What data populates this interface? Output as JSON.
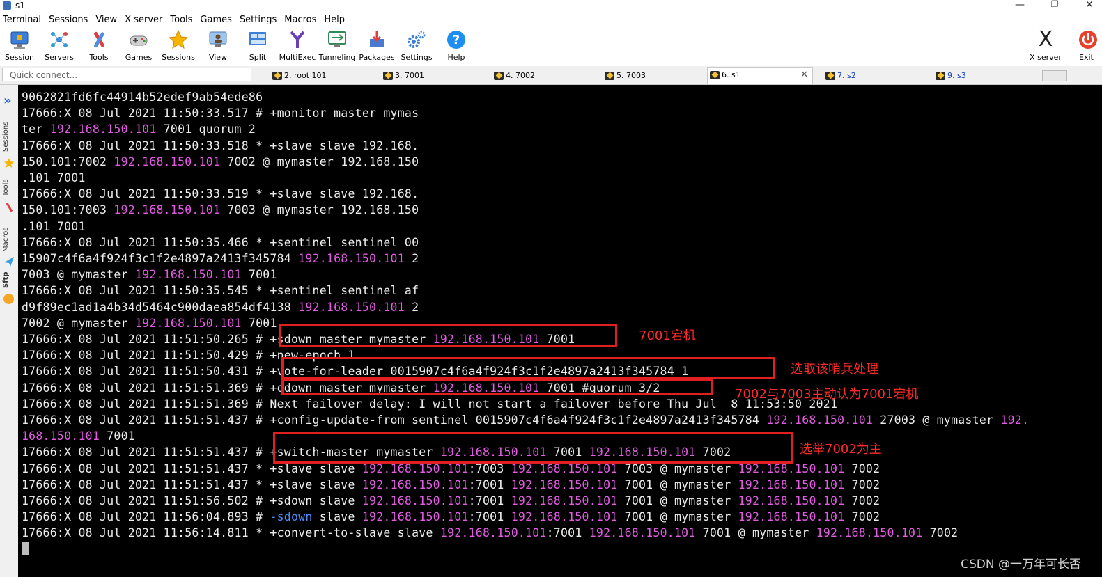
{
  "window": {
    "title": "s1",
    "min_glyph": "—",
    "max_glyph": "❐",
    "close_glyph": "✕"
  },
  "menu": [
    "Terminal",
    "Sessions",
    "View",
    "X server",
    "Tools",
    "Games",
    "Settings",
    "Macros",
    "Help"
  ],
  "toolbar": [
    {
      "label": "Session",
      "icon": "session-icon"
    },
    {
      "label": "Servers",
      "icon": "servers-icon"
    },
    {
      "label": "Tools",
      "icon": "tools-icon"
    },
    {
      "label": "Games",
      "icon": "games-icon"
    },
    {
      "label": "Sessions",
      "icon": "star-icon"
    },
    {
      "label": "View",
      "icon": "view-icon"
    },
    {
      "label": "Split",
      "icon": "split-icon"
    },
    {
      "label": "MultiExec",
      "icon": "multiexec-icon"
    },
    {
      "label": "Tunneling",
      "icon": "tunneling-icon"
    },
    {
      "label": "Packages",
      "icon": "packages-icon"
    },
    {
      "label": "Settings",
      "icon": "gear-icon"
    },
    {
      "label": "Help",
      "icon": "help-icon"
    }
  ],
  "xserver": {
    "label": "X server",
    "glyph": "X"
  },
  "exit": {
    "label": "Exit"
  },
  "quick_connect": {
    "placeholder": "Quick connect..."
  },
  "tabs": [
    {
      "label": "2. root 101",
      "active": false
    },
    {
      "label": "3. 7001",
      "active": false
    },
    {
      "label": "4. 7002",
      "active": false
    },
    {
      "label": "5. 7003",
      "active": false
    },
    {
      "label": "6. s1",
      "active": true
    },
    {
      "label": "7. s2",
      "active": false
    },
    {
      "label": "9. s3",
      "active": false
    }
  ],
  "tab_close": "✕",
  "side_panel": [
    "Sessions",
    "Tools",
    "Macros",
    "Sftp"
  ],
  "side_arrow": "»",
  "terminal_lines": [
    [
      {
        "t": "9062821fd6fc44914b52edef9ab54ede86"
      }
    ],
    [
      {
        "t": "17666:X 08 Jul 2021 11:50:33.517 # +monitor master mymas"
      }
    ],
    [
      {
        "t": "ter "
      },
      {
        "t": "192.168.150.101",
        "c": "ip"
      },
      {
        "t": " 7001 quorum 2"
      }
    ],
    [
      {
        "t": "17666:X 08 Jul 2021 11:50:33.518 * +slave slave 192.168."
      }
    ],
    [
      {
        "t": "150.101:7002 "
      },
      {
        "t": "192.168.150.101",
        "c": "ip"
      },
      {
        "t": " 7002 @ mymaster 192.168.150"
      }
    ],
    [
      {
        "t": ".101 7001"
      }
    ],
    [
      {
        "t": "17666:X 08 Jul 2021 11:50:33.519 * +slave slave 192.168."
      }
    ],
    [
      {
        "t": "150.101:7003 "
      },
      {
        "t": "192.168.150.101",
        "c": "ip"
      },
      {
        "t": " 7003 @ mymaster 192.168.150"
      }
    ],
    [
      {
        "t": ".101 7001"
      }
    ],
    [
      {
        "t": "17666:X 08 Jul 2021 11:50:35.466 * +sentinel sentinel 00"
      }
    ],
    [
      {
        "t": "15907c4f6a4f924f3c1f2e4897a2413f345784 "
      },
      {
        "t": "192.168.150.101",
        "c": "ip"
      },
      {
        "t": " 2"
      }
    ],
    [
      {
        "t": "7003 @ mymaster "
      },
      {
        "t": "192.168.150.101",
        "c": "ip"
      },
      {
        "t": " 7001"
      }
    ],
    [
      {
        "t": "17666:X 08 Jul 2021 11:50:35.545 * +sentinel sentinel af"
      }
    ],
    [
      {
        "t": "d9f89ec1ad1a4b34d5464c900daea854df4138 "
      },
      {
        "t": "192.168.150.101",
        "c": "ip"
      },
      {
        "t": " 2"
      }
    ],
    [
      {
        "t": "7002 @ mymaster "
      },
      {
        "t": "192.168.150.101",
        "c": "ip"
      },
      {
        "t": " 7001"
      }
    ],
    [
      {
        "t": "17666:X 08 Jul 2021 11:51:50.265 # +sdown master mymaster "
      },
      {
        "t": "192.168.150.101",
        "c": "ip"
      },
      {
        "t": " 7001"
      }
    ],
    [
      {
        "t": "17666:X 08 Jul 2021 11:51:50.429 # +new-epoch 1"
      }
    ],
    [
      {
        "t": "17666:X 08 Jul 2021 11:51:50.431 # +vote-for-leader 0015907c4f6a4f924f3c1f2e4897a2413f345784 1"
      }
    ],
    [
      {
        "t": "17666:X 08 Jul 2021 11:51:51.369 # +odown master mymaster "
      },
      {
        "t": "192.168.150.101",
        "c": "ip"
      },
      {
        "t": " 7001 #quorum 3/2"
      }
    ],
    [
      {
        "t": "17666:X 08 Jul 2021 11:51:51.369 # Next failover delay: I will not start a failover before Thu Jul  8 11:53:50 2021"
      }
    ],
    [
      {
        "t": "17666:X 08 Jul 2021 11:51:51.437 # +config-update-from sentinel 0015907c4f6a4f924f3c1f2e4897a2413f345784 "
      },
      {
        "t": "192.168.150.101",
        "c": "ip"
      },
      {
        "t": " 27003 @ mymaster "
      },
      {
        "t": "192.",
        "c": "ip"
      }
    ],
    [
      {
        "t": "168.150.101",
        "c": "ip"
      },
      {
        "t": " 7001"
      }
    ],
    [
      {
        "t": "17666:X 08 Jul 2021 11:51:51.437 # +switch-master mymaster "
      },
      {
        "t": "192.168.150.101",
        "c": "ip"
      },
      {
        "t": " 7001 "
      },
      {
        "t": "192.168.150.101",
        "c": "ip"
      },
      {
        "t": " 7002"
      }
    ],
    [
      {
        "t": "17666:X 08 Jul 2021 11:51:51.437 * +slave slave "
      },
      {
        "t": "192.168.150.101",
        "c": "ip"
      },
      {
        "t": ":7003 "
      },
      {
        "t": "192.168.150.101",
        "c": "ip"
      },
      {
        "t": " 7003 @ mymaster "
      },
      {
        "t": "192.168.150.101",
        "c": "ip"
      },
      {
        "t": " 7002"
      }
    ],
    [
      {
        "t": "17666:X 08 Jul 2021 11:51:51.437 * +slave slave "
      },
      {
        "t": "192.168.150.101",
        "c": "ip"
      },
      {
        "t": ":7001 "
      },
      {
        "t": "192.168.150.101",
        "c": "ip"
      },
      {
        "t": " 7001 @ mymaster "
      },
      {
        "t": "192.168.150.101",
        "c": "ip"
      },
      {
        "t": " 7002"
      }
    ],
    [
      {
        "t": "17666:X 08 Jul 2021 11:51:56.502 # +sdown slave "
      },
      {
        "t": "192.168.150.101",
        "c": "ip"
      },
      {
        "t": ":7001 "
      },
      {
        "t": "192.168.150.101",
        "c": "ip"
      },
      {
        "t": " 7001 @ mymaster "
      },
      {
        "t": "192.168.150.101",
        "c": "ip"
      },
      {
        "t": " 7002"
      }
    ],
    [
      {
        "t": "17666:X 08 Jul 2021 11:56:04.893 # "
      },
      {
        "t": "-sdown",
        "c": "blue"
      },
      {
        "t": " slave "
      },
      {
        "t": "192.168.150.101",
        "c": "ip"
      },
      {
        "t": ":7001 "
      },
      {
        "t": "192.168.150.101",
        "c": "ip"
      },
      {
        "t": " 7001 @ mymaster "
      },
      {
        "t": "192.168.150.101",
        "c": "ip"
      },
      {
        "t": " 7002"
      }
    ],
    [
      {
        "t": "17666:X 08 Jul 2021 11:56:14.811 * +convert-to-slave slave "
      },
      {
        "t": "192.168.150.101",
        "c": "ip"
      },
      {
        "t": ":7001 "
      },
      {
        "t": "192.168.150.101",
        "c": "ip"
      },
      {
        "t": " 7001 @ mymaster "
      },
      {
        "t": "192.168.150.101",
        "c": "ip"
      },
      {
        "t": " 7002"
      }
    ]
  ],
  "annotations": {
    "sdown": "7001宕机",
    "vote": "选取该哨兵处理",
    "odown": "7002与7003主动认为7001宕机",
    "switch": "选举7002为主"
  },
  "watermark": "CSDN @一万年可长否",
  "colors": {
    "terminal_bg": "#000000",
    "text": "#ececec",
    "ip": "#e35ce3",
    "highlight": "#e02020"
  }
}
